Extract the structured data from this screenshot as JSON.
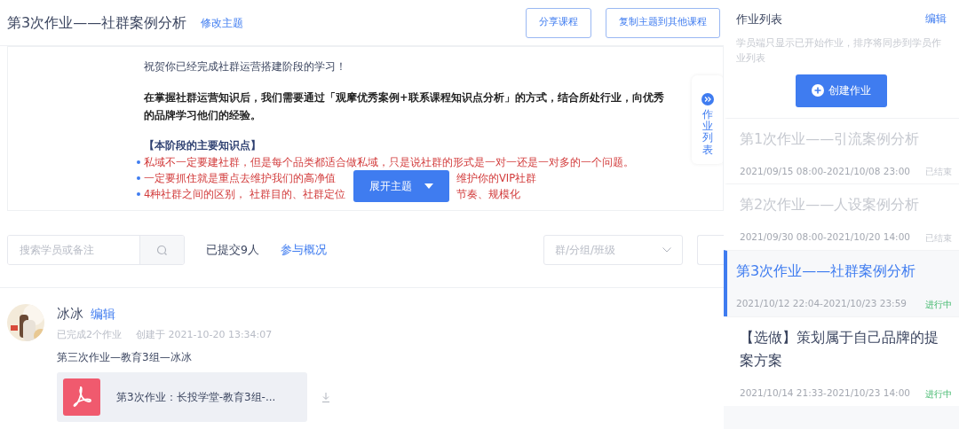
{
  "header": {
    "title": "第3次作业——社群案例分析",
    "edit_link": "修改主题",
    "buttons": [
      "分享课程",
      "复制主题到其他课程"
    ]
  },
  "topic": {
    "greeting": "祝贺你已经完成社群运营搭建阶段的学习！",
    "intro": "在掌握社群运营知识后，我们需要通过「观摩优秀案例+联系课程知识点分析」的方式，结合所处行业，向优秀的品牌学习他们的经验。",
    "section_heading": "【本阶段的主要知识点】",
    "points": [
      {
        "left": "私域不一定要建社群，但是每个品类都适合做私域，只是说社群的形式是一对一还是一对多的一个问题。"
      },
      {
        "left": "一定要抓住就是重点去维护我们的高净值",
        "right": "维护你的VIP社群"
      },
      {
        "left": "4种社群之间的区别， 社群目的、社群定位",
        "right": "节奏、规模化"
      }
    ],
    "expand_button": "展开主题",
    "side_tab": "作业列表"
  },
  "filters": {
    "search_placeholder": "搜索学员或备注",
    "submitted": "已提交9人",
    "overview_link": "参与概况",
    "group_placeholder": "群/分组/班级"
  },
  "submissions": [
    {
      "name": "冰冰",
      "edit_link": "编辑",
      "completed": "已完成2个作业",
      "created": "创建于 2021-10-20 13:34:07",
      "caption": "第三次作业—教育3组—冰冰",
      "file": "第3次作业：长投学堂-教育3组-..."
    }
  ],
  "sidebar": {
    "title": "作业列表",
    "edit_link": "编辑",
    "hint": "学员端只显示已开始作业，排序将同步到学员作业列表",
    "create_button": "创建作业",
    "items": [
      {
        "title": "第1次作业——引流案例分析",
        "dates": "2021/09/15 08:00-2021/10/08 23:00",
        "status": "已结束",
        "ended": true,
        "selected": false
      },
      {
        "title": "第2次作业——人设案例分析",
        "dates": "2021/09/30 08:00-2021/10/20 14:00",
        "status": "已结束",
        "ended": true,
        "selected": false
      },
      {
        "title": "第3次作业——社群案例分析",
        "dates": "2021/10/12 22:04-2021/10/23 23:59",
        "status": "进行中",
        "ended": false,
        "selected": true
      },
      {
        "title": "【选做】策划属于自己品牌的提案方案",
        "dates": "2021/10/14 21:33-2021/10/23 14:00",
        "status": "进行中",
        "ended": false,
        "selected": false
      }
    ]
  }
}
